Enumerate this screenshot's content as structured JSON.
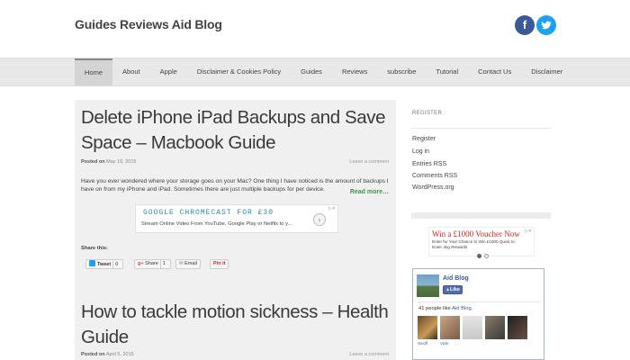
{
  "header": {
    "site_title": "Guides Reviews Aid Blog",
    "social": [
      {
        "name": "facebook",
        "glyph": "f",
        "color": "#3b5998"
      },
      {
        "name": "twitter",
        "glyph": "t",
        "color": "#1da1f2"
      }
    ]
  },
  "nav": {
    "items": [
      "Home",
      "About",
      "Apple",
      "Disclaimer & Cookies Policy",
      "Guides",
      "Reviews",
      "subscribe",
      "Tutorial",
      "Contact Us",
      "Disclaimer"
    ],
    "active": "Home"
  },
  "posts": [
    {
      "title_line1": "Delete iPhone iPad Backups and Save",
      "title_line2": "Space – Macbook Guide",
      "posted_label": "Posted on",
      "date": "May 19, 2015",
      "comment_link": "Leave a comment",
      "excerpt": "Have you ever wondered where your storage goes on your Mac? One thing I have noticed is the amount of backups I have on from my iPhone and iPad. Sometimes there are just multiple backups for per device.",
      "read_more": "Read more…"
    },
    {
      "title_line1": "How to tackle motion sickness – Health",
      "title_line2": "Guide",
      "posted_label": "Posted on",
      "date": "April 5, 2015",
      "comment_link": "Leave a comment"
    }
  ],
  "ad": {
    "title": "GOOGLE CHROMECAST FOR £30",
    "text": "Stream Online Video From YouTube, Google Play or Netflix to y...",
    "arrow": "›"
  },
  "share": {
    "title": "Share this:",
    "tweet": "Tweet",
    "tweet_count": "0",
    "gplus": "Share",
    "gplus_count": "1",
    "email": "Email",
    "pinterest": "Pin it"
  },
  "sidebar": {
    "register_title": "REGISTER",
    "links": [
      "Register",
      "Log in",
      "Entries RSS",
      "Comments RSS",
      "WordPress.org"
    ],
    "ad_title": "Win a £1000 Voucher Now",
    "ad_text": "Enter for Your Chance to Win £1000 Quick to Enter, Big Rewards",
    "facebook": {
      "page_name": "Aid Blog",
      "like_label": "Like",
      "likes_text": "41 people like",
      "likes_page": "Aid Blog.",
      "face_names": [
        "Geoff",
        "Vicki",
        "",
        "",
        "",
        ""
      ]
    }
  },
  "colors": {
    "link_green": "#3a9a3a",
    "nav_bg": "#e8e8e8",
    "post_bg": "#f0f0f0",
    "facebook_blue": "#3b5998"
  }
}
